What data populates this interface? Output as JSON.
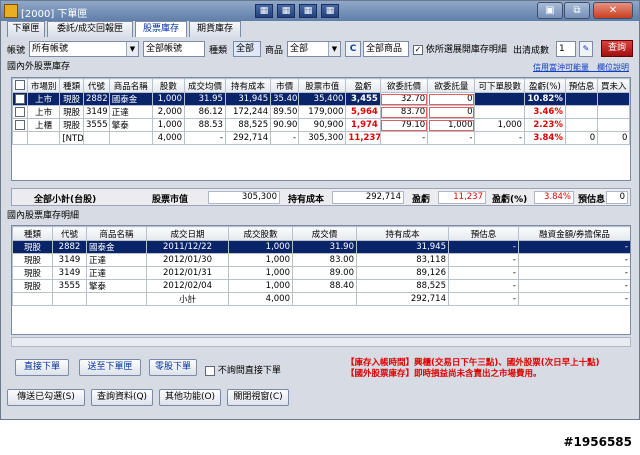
{
  "window": {
    "title": "[2000] 下單匣",
    "buttons": [
      "▣",
      "⧉",
      "✕",
      "✕"
    ]
  },
  "titlebar_tools": [
    "▦",
    "▦",
    "▦",
    "▦"
  ],
  "tabs": [
    {
      "label": "下單匣",
      "active": false
    },
    {
      "label": "委託/成交回報匣",
      "active": false
    },
    {
      "label": "股票庫存",
      "active": true
    },
    {
      "label": "期貨庫存",
      "active": false
    }
  ],
  "filters": {
    "account_label": "帳號",
    "account_value": "所有帳號",
    "account2_value": "全部帳號",
    "type_label": "種類",
    "type_value": "全部",
    "product_label": "商品",
    "product_value": "全部",
    "c_button": "C",
    "all_products": "全部商品",
    "check_label": "依所選展開庫存明細",
    "sold_label": "出清成數",
    "sold_value": "1",
    "query_button": "查詢"
  },
  "section1_title": "國內外股票庫存",
  "links": "信用當沖可能量　欄位說明",
  "grid1": {
    "headers": [
      "",
      "市場別",
      "種類",
      "代號",
      "商品名稱",
      "股數",
      "成交均價",
      "持有成本",
      "市價",
      "股票市值",
      "盈虧",
      "欲委託價",
      "欲委託量",
      "可下單股數",
      "盈虧(%)",
      "預估息",
      "買未入",
      "賣未"
    ],
    "rows": [
      {
        "selected": true,
        "cells": [
          "",
          "上市",
          "現股",
          "2882",
          "國泰金",
          "1,000",
          "31.95",
          "31,945",
          "35.40",
          "35,400",
          "3,455",
          "32.70",
          "0",
          "",
          "10.82%",
          "",
          "",
          ""
        ]
      },
      {
        "selected": false,
        "cells": [
          "",
          "上市",
          "現股",
          "3149",
          "正達",
          "2,000",
          "86.12",
          "172,244",
          "89.50",
          "179,000",
          "5,964",
          "83.70",
          "0",
          "",
          "3.46%",
          "",
          "",
          ""
        ]
      },
      {
        "selected": false,
        "cells": [
          "",
          "上櫃",
          "現股",
          "3555",
          "擎泰",
          "1,000",
          "88.53",
          "88,525",
          "90.90",
          "90,900",
          "1,974",
          "79.10",
          "1,000",
          "1,000",
          "2.23%",
          "",
          "",
          ""
        ]
      },
      {
        "selected": false,
        "cells": [
          "",
          "",
          "[NTD台幣]小計",
          "",
          "",
          "4,000",
          "-",
          "292,714",
          "-",
          "305,300",
          "11,237",
          "-",
          "-",
          "-",
          "3.84%",
          "0",
          "0",
          ""
        ]
      }
    ]
  },
  "summary": {
    "total_label": "全部小計(台股)",
    "market_value_label": "股票市值",
    "market_value": "305,300",
    "cost_label": "持有成本",
    "cost": "292,714",
    "pnl_label": "盈虧",
    "pnl": "11,237",
    "pnl_pct_label": "盈虧(%)",
    "pnl_pct": "3.84%",
    "est_div_label": "預估息",
    "est_div": "0"
  },
  "section2_title": "國內股票庫存明細",
  "grid2": {
    "headers": [
      "種類",
      "代號",
      "商品名稱",
      "成交日期",
      "成交股數",
      "成交價",
      "持有成本",
      "預估息",
      "融資金額/券擔保品"
    ],
    "rows": [
      {
        "selected": true,
        "cells": [
          "現股",
          "2882",
          "國泰金",
          "2011/12/22",
          "1,000",
          "31.90",
          "31,945",
          "-",
          "-"
        ]
      },
      {
        "selected": false,
        "cells": [
          "現股",
          "3149",
          "正達",
          "2012/01/30",
          "1,000",
          "83.00",
          "83,118",
          "-",
          "-"
        ]
      },
      {
        "selected": false,
        "cells": [
          "現股",
          "3149",
          "正達",
          "2012/01/31",
          "1,000",
          "89.00",
          "89,126",
          "-",
          "-"
        ]
      },
      {
        "selected": false,
        "cells": [
          "現股",
          "3555",
          "擎泰",
          "2012/02/04",
          "1,000",
          "88.40",
          "88,525",
          "-",
          "-"
        ]
      },
      {
        "selected": false,
        "cells": [
          "",
          "",
          "",
          "小計",
          "4,000",
          "",
          "292,714",
          "-",
          "-"
        ]
      }
    ]
  },
  "actions": {
    "direct_order": "直接下單",
    "send_to_box": "送至下單匣",
    "odd_lot": "零股下單",
    "no_confirm": "不詢問直接下單",
    "send_checked": "傳送已勾選(S)",
    "query_data": "查詢資料(Q)",
    "other_funcs": "其他功能(O)",
    "close_window": "關閉視窗(C)"
  },
  "note_line1": "【庫存入帳時間】興櫃(交易日下午三點)、國外股票(次日早上十點)",
  "note_line2": "【國外股票庫存】即時損益尚未含賣出之市場費用。",
  "watermark": "#1956585"
}
